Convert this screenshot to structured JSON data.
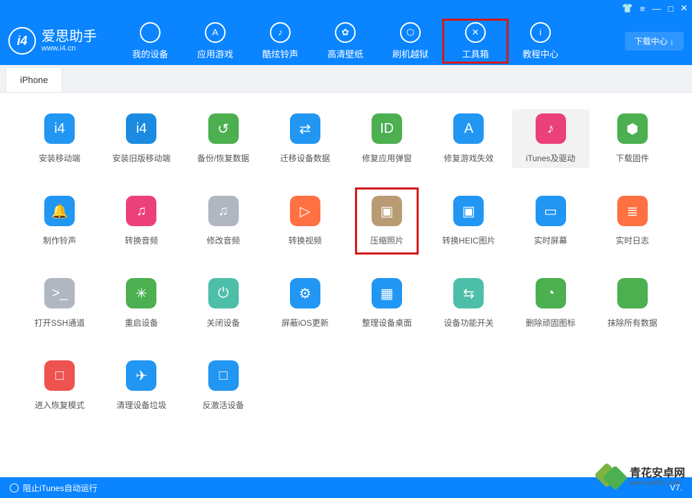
{
  "brand": {
    "title": "爱思助手",
    "subtitle": "www.i4.cn"
  },
  "nav": [
    {
      "label": "我的设备"
    },
    {
      "label": "应用游戏"
    },
    {
      "label": "酷炫铃声"
    },
    {
      "label": "高清壁纸"
    },
    {
      "label": "刷机越狱"
    },
    {
      "label": "工具箱"
    },
    {
      "label": "教程中心"
    }
  ],
  "download_btn": "下载中心 ↓",
  "tab": "iPhone",
  "tools": [
    {
      "label": "安装移动端",
      "color": "c-blue",
      "glyph": "i4"
    },
    {
      "label": "安装旧版移动端",
      "color": "c-blue2",
      "glyph": "i4"
    },
    {
      "label": "备份/恢复数据",
      "color": "c-green",
      "glyph": "↺"
    },
    {
      "label": "迁移设备数据",
      "color": "c-blue",
      "glyph": "⇄"
    },
    {
      "label": "修复应用弹窗",
      "color": "c-green",
      "glyph": "ID"
    },
    {
      "label": "修复游戏失效",
      "color": "c-blue",
      "glyph": "A"
    },
    {
      "label": "iTunes及驱动",
      "color": "c-pink",
      "glyph": "♪",
      "selected": true
    },
    {
      "label": "下载固件",
      "color": "c-green",
      "glyph": "⬢"
    },
    {
      "label": "制作铃声",
      "color": "c-blue",
      "glyph": "🔔"
    },
    {
      "label": "转换音频",
      "color": "c-pink",
      "glyph": "♫"
    },
    {
      "label": "修改音频",
      "color": "c-gray",
      "glyph": "♫"
    },
    {
      "label": "转换视频",
      "color": "c-orange",
      "glyph": "▷"
    },
    {
      "label": "压缩照片",
      "color": "c-beige",
      "glyph": "▣",
      "highlight": true
    },
    {
      "label": "转换HEIC图片",
      "color": "c-blue",
      "glyph": "▣"
    },
    {
      "label": "实时屏幕",
      "color": "c-blue",
      "glyph": "▭"
    },
    {
      "label": "实时日志",
      "color": "c-orange",
      "glyph": "≣"
    },
    {
      "label": "打开SSH通道",
      "color": "c-gray",
      "glyph": ">_"
    },
    {
      "label": "重启设备",
      "color": "c-green",
      "glyph": "✳"
    },
    {
      "label": "关闭设备",
      "color": "c-mint",
      "glyph": "⏻"
    },
    {
      "label": "屏蔽iOS更新",
      "color": "c-blue",
      "glyph": "⚙"
    },
    {
      "label": "整理设备桌面",
      "color": "c-blue",
      "glyph": "▦"
    },
    {
      "label": "设备功能开关",
      "color": "c-mint",
      "glyph": "⇆"
    },
    {
      "label": "删除顽固图标",
      "color": "c-green",
      "glyph": "◔"
    },
    {
      "label": "抹除所有数据",
      "color": "c-green",
      "glyph": ""
    },
    {
      "label": "进入恢复模式",
      "color": "c-red",
      "glyph": "□"
    },
    {
      "label": "清理设备垃圾",
      "color": "c-blue",
      "glyph": "✈"
    },
    {
      "label": "反激活设备",
      "color": "c-blue",
      "glyph": "□"
    }
  ],
  "footer": {
    "left": "阻止iTunes自动运行",
    "right": "V7."
  },
  "watermark": {
    "title": "青花安卓网",
    "sub": "www.qhhlv.com"
  }
}
